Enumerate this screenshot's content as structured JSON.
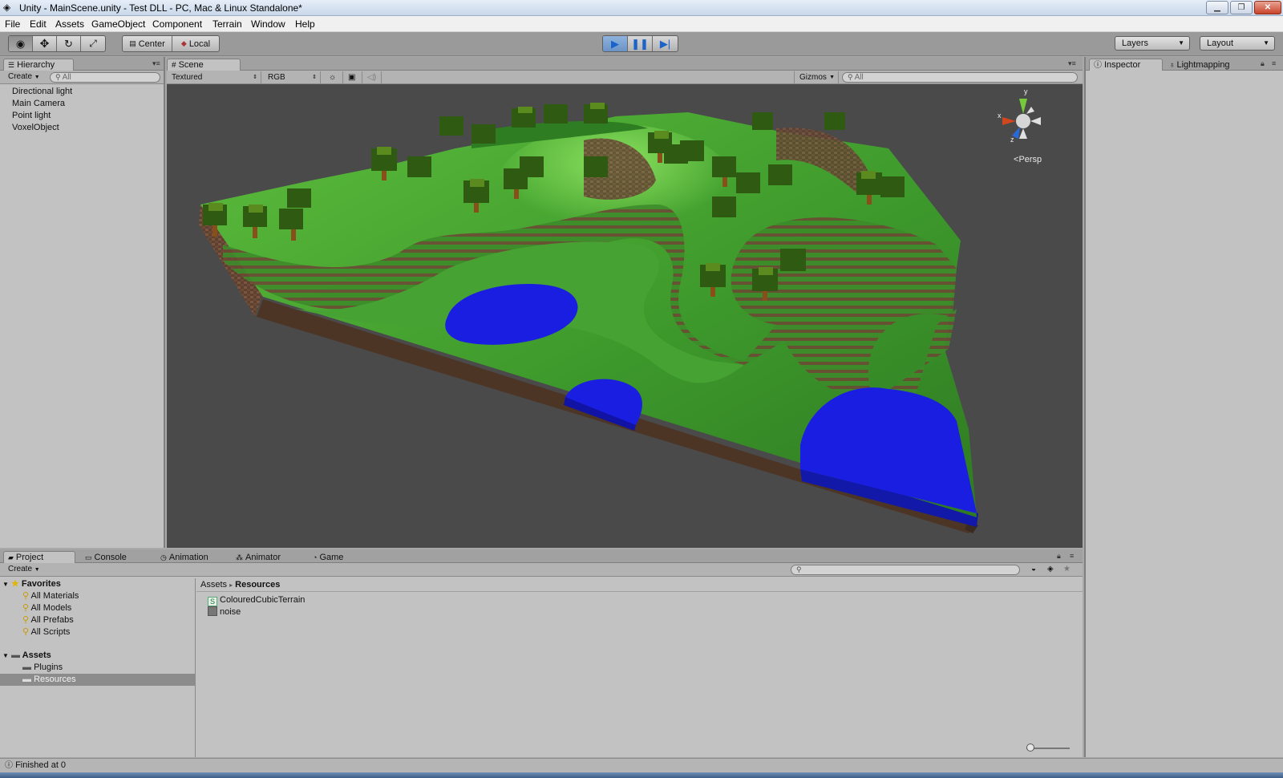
{
  "window": {
    "title": "Unity - MainScene.unity - Test DLL - PC, Mac & Linux Standalone*",
    "minimize": "▁",
    "maximize": "❐",
    "close": "✕"
  },
  "menubar": [
    "File",
    "Edit",
    "Assets",
    "GameObject",
    "Component",
    "Terrain",
    "Window",
    "Help"
  ],
  "toolbar": {
    "pivot_center": "Center",
    "pivot_local": "Local",
    "layers": "Layers",
    "layout": "Layout"
  },
  "hierarchy": {
    "tab": "Hierarchy",
    "create": "Create",
    "search_placeholder": "All",
    "items": [
      "Directional light",
      "Main Camera",
      "Point light",
      "VoxelObject"
    ]
  },
  "scene": {
    "tab": "Scene",
    "render_mode": "Textured",
    "color_mode": "RGB",
    "gizmos": "Gizmos",
    "search_placeholder": "All",
    "projection": "Persp",
    "axis_x": "x",
    "axis_y": "y",
    "axis_z": "z"
  },
  "inspector": {
    "tab_inspector": "Inspector",
    "tab_lightmapping": "Lightmapping"
  },
  "bottom_tabs": [
    "Project",
    "Console",
    "Animation",
    "Animator",
    "Game"
  ],
  "project": {
    "create": "Create",
    "favorites_label": "Favorites",
    "favorites": [
      "All Materials",
      "All Models",
      "All Prefabs",
      "All Scripts"
    ],
    "assets_label": "Assets",
    "asset_folders": [
      "Plugins",
      "Resources"
    ],
    "selected_folder": "Resources",
    "breadcrumb_root": "Assets",
    "breadcrumb_sep": "▸",
    "breadcrumb_current": "Resources",
    "files": [
      {
        "name": "ColouredCubicTerrain",
        "icon": "script-icon",
        "badge": "S"
      },
      {
        "name": "noise",
        "icon": "texture-icon",
        "badge": ""
      }
    ]
  },
  "status": {
    "message": "Finished at 0"
  },
  "colors": {
    "play_active": "#6a93c6",
    "viewport_bg": "#4a4a4a",
    "grass": "#3f9a2e",
    "water": "#1a1ee0",
    "dirt": "#6b4a34"
  }
}
